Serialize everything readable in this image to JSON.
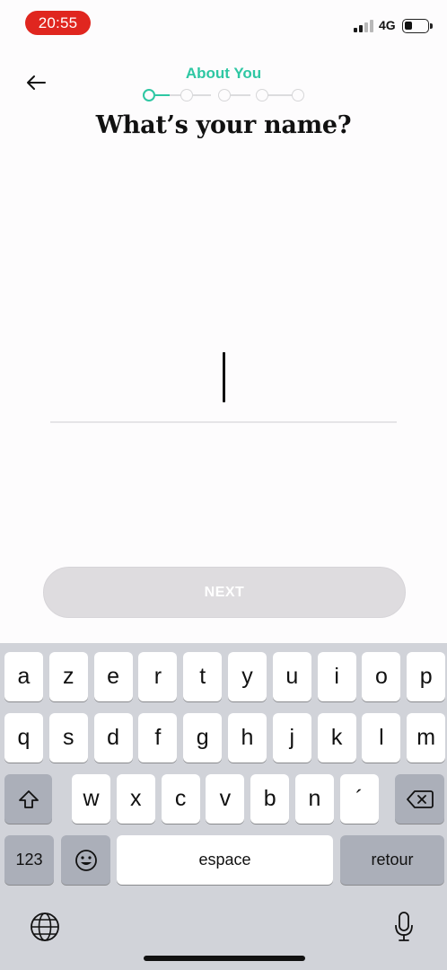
{
  "status_bar": {
    "time": "20:55",
    "network": "4G"
  },
  "header": {
    "section_label": "About You",
    "title": "What’s your name?",
    "current_step": 1,
    "total_steps": 5
  },
  "form": {
    "name_value": "",
    "name_placeholder": ""
  },
  "actions": {
    "next_label": "NEXT"
  },
  "keyboard": {
    "row1": [
      "a",
      "z",
      "e",
      "r",
      "t",
      "y",
      "u",
      "i",
      "o",
      "p"
    ],
    "row2": [
      "q",
      "s",
      "d",
      "f",
      "g",
      "h",
      "j",
      "k",
      "l",
      "m"
    ],
    "row3": [
      "w",
      "x",
      "c",
      "v",
      "b",
      "n",
      "´"
    ],
    "numbers_label": "123",
    "space_label": "espace",
    "return_label": "retour"
  },
  "icons": [
    "back-arrow-icon",
    "shift-icon",
    "backspace-icon",
    "emoji-icon",
    "globe-icon",
    "microphone-icon"
  ],
  "colors": {
    "accent": "#2ec7a3",
    "time_pill": "#e0261f",
    "next_disabled": "#dedcdf"
  }
}
